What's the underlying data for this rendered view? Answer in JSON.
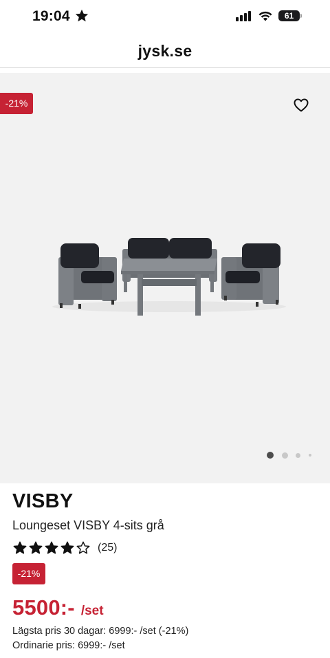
{
  "status_bar": {
    "time": "19:04",
    "battery": "61",
    "battery_level": 0.61
  },
  "browser": {
    "url": "jysk.se"
  },
  "gallery": {
    "discount": "-21%",
    "slide_count": 4,
    "active_slide": 1
  },
  "product": {
    "brand": "VISBY",
    "name": "Loungeset VISBY 4-sits grå",
    "rating": 4,
    "rating_max": 5,
    "review_count": "(25)",
    "discount_badge": "-21%",
    "price": "5500:-",
    "price_unit": "/set",
    "lowest_price_note": "Lägsta pris 30 dagar: 6999:- /set (-21%)",
    "ordinary_price_note": "Ordinarie pris: 6999:- /set"
  },
  "colors": {
    "accent_red": "#c62234",
    "gallery_bg": "#f2f2f2"
  },
  "icons": [
    "star-icon",
    "cellular-signal-icon",
    "wifi-icon",
    "battery-icon",
    "heart-icon",
    "rating-star-icon"
  ]
}
